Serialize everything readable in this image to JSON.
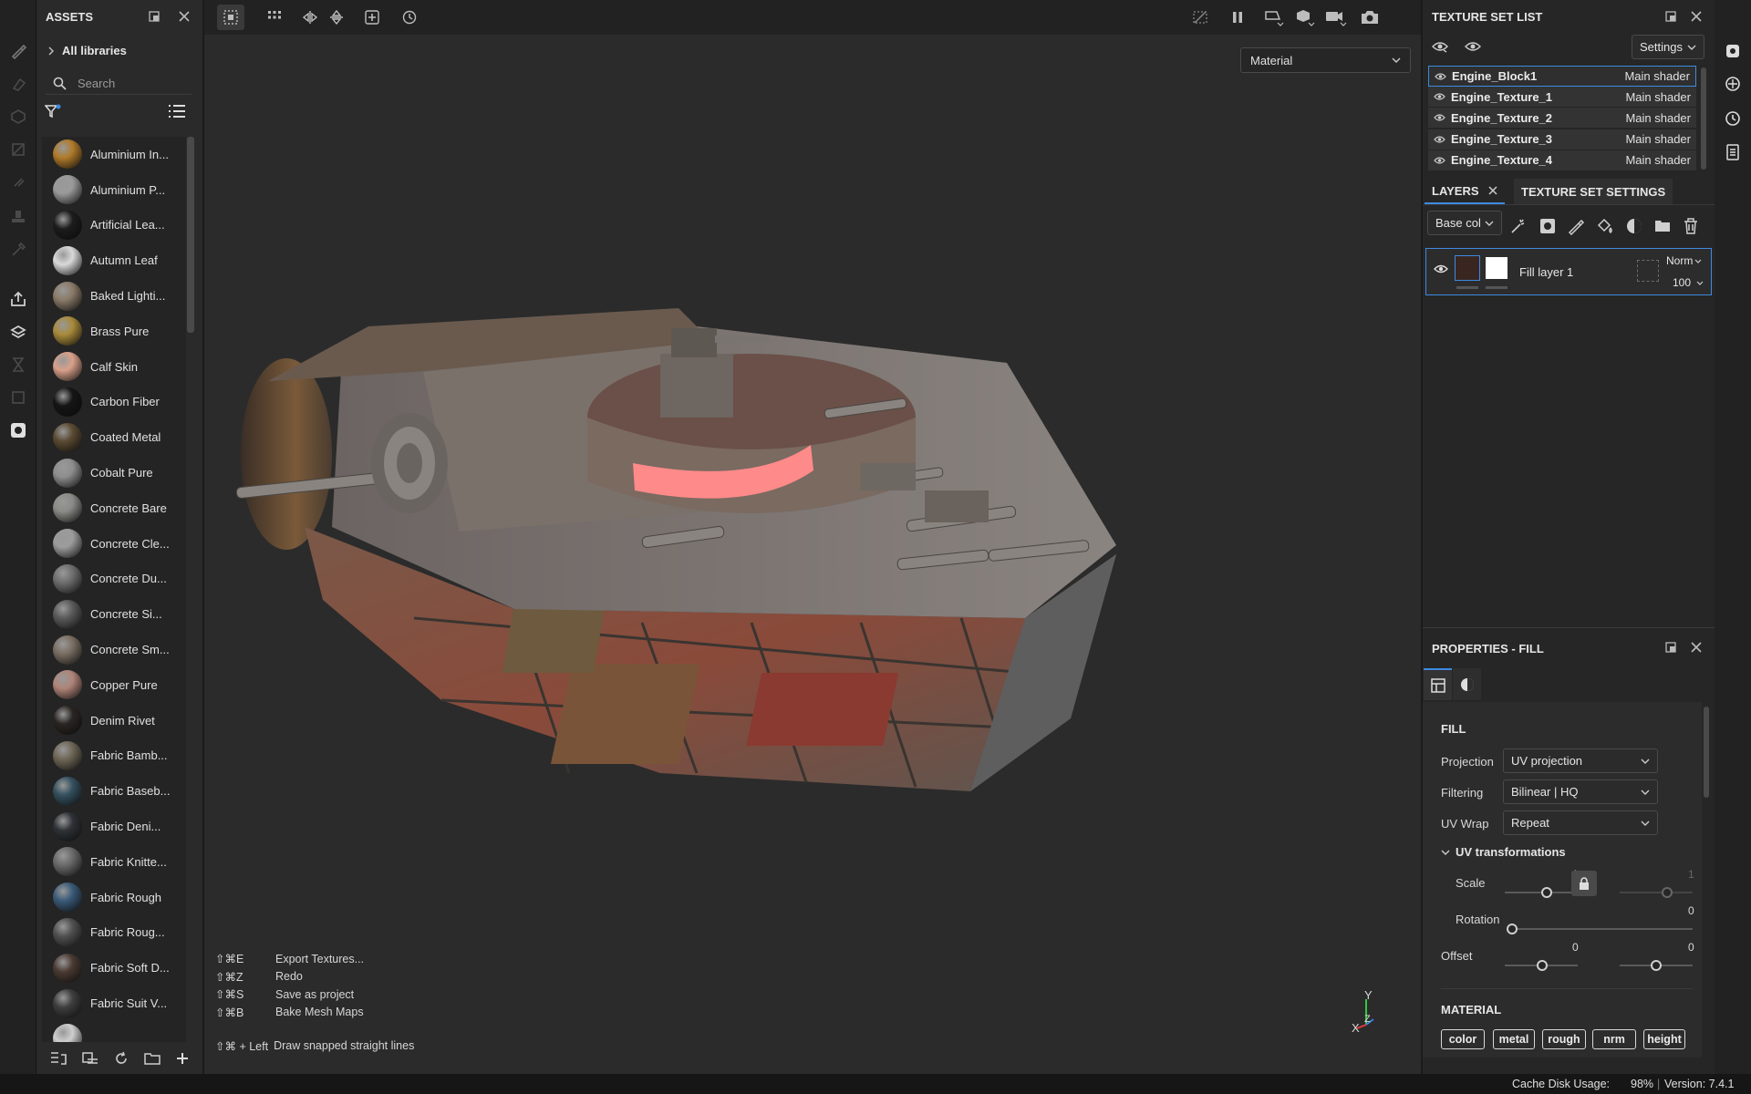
{
  "assets": {
    "title": "ASSETS",
    "all_libraries": "All libraries",
    "search_placeholder": "Search",
    "items": [
      {
        "label": "Aluminium In...",
        "color": "#b07a2a"
      },
      {
        "label": "Aluminium P...",
        "color": "#9a9a9a"
      },
      {
        "label": "Artificial Lea...",
        "color": "#1c1c1c"
      },
      {
        "label": "Autumn Leaf",
        "color": "#d9d9d9"
      },
      {
        "label": "Baked Lighti...",
        "color": "#8a7a68"
      },
      {
        "label": "Brass Pure",
        "color": "#a88a3a"
      },
      {
        "label": "Calf Skin",
        "color": "#d9a08a"
      },
      {
        "label": "Carbon Fiber",
        "color": "#151515"
      },
      {
        "label": "Coated Metal",
        "color": "#5a4a32"
      },
      {
        "label": "Cobalt Pure",
        "color": "#8e8e8e"
      },
      {
        "label": "Concrete Bare",
        "color": "#8a8a86"
      },
      {
        "label": "Concrete Cle...",
        "color": "#9c9c9c"
      },
      {
        "label": "Concrete Du...",
        "color": "#6e6e6e"
      },
      {
        "label": "Concrete Si...",
        "color": "#5a5a5a"
      },
      {
        "label": "Concrete Sm...",
        "color": "#7a6e62"
      },
      {
        "label": "Copper Pure",
        "color": "#b08478"
      },
      {
        "label": "Denim Rivet",
        "color": "#2a2522"
      },
      {
        "label": "Fabric Bamb...",
        "color": "#6e6656"
      },
      {
        "label": "Fabric Baseb...",
        "color": "#34505e"
      },
      {
        "label": "Fabric Deni...",
        "color": "#2e3236"
      },
      {
        "label": "Fabric Knitte...",
        "color": "#6a6a6a"
      },
      {
        "label": "Fabric Rough",
        "color": "#3a5a78"
      },
      {
        "label": "Fabric Roug...",
        "color": "#505050"
      },
      {
        "label": "Fabric Soft D...",
        "color": "#4a3a32"
      },
      {
        "label": "Fabric Suit V...",
        "color": "#3e3e3e"
      },
      {
        "label": "",
        "color": "#cfcfcf"
      }
    ]
  },
  "viewport": {
    "material_select": "Material",
    "shortcuts": [
      {
        "keys": "⇧⌘E",
        "action": "Export Textures..."
      },
      {
        "keys": "⇧⌘Z",
        "action": "Redo"
      },
      {
        "keys": "⇧⌘S",
        "action": "Save as project"
      },
      {
        "keys": "⇧⌘B",
        "action": "Bake Mesh Maps"
      }
    ],
    "snap_hint_keys": "⇧⌘ + Left",
    "snap_hint_action": "Draw snapped straight lines",
    "axis": {
      "x": "X",
      "y": "Y",
      "z": "Z"
    }
  },
  "texture_set_list": {
    "title": "TEXTURE SET LIST",
    "settings_label": "Settings",
    "items": [
      {
        "name": "Engine_Block1",
        "shader": "Main shader",
        "selected": true
      },
      {
        "name": "Engine_Texture_1",
        "shader": "Main shader",
        "selected": false
      },
      {
        "name": "Engine_Texture_2",
        "shader": "Main shader",
        "selected": false
      },
      {
        "name": "Engine_Texture_3",
        "shader": "Main shader",
        "selected": false
      },
      {
        "name": "Engine_Texture_4",
        "shader": "Main shader",
        "selected": false
      }
    ]
  },
  "layers": {
    "tab_layers": "LAYERS",
    "tab_texture_set_settings": "TEXTURE SET SETTINGS",
    "channel_select": "Base col",
    "layer_name": "Fill layer 1",
    "blend_mode": "Norm",
    "opacity": "100"
  },
  "properties": {
    "title": "PROPERTIES - FILL",
    "fill_header": "FILL",
    "projection_label": "Projection",
    "projection_value": "UV projection",
    "filtering_label": "Filtering",
    "filtering_value": "Bilinear | HQ",
    "uvwrap_label": "UV Wrap",
    "uvwrap_value": "Repeat",
    "uv_transformations": "UV transformations",
    "scale_label": "Scale",
    "scale_value": "1",
    "scale_value2": "1",
    "rotation_label": "Rotation",
    "rotation_value": "0",
    "offset_label": "Offset",
    "offset_x": "0",
    "offset_y": "0",
    "material_header": "MATERIAL",
    "channels": [
      "color",
      "metal",
      "rough",
      "nrm",
      "height"
    ]
  },
  "status": {
    "cache_label": "Cache Disk Usage:",
    "cache_value": "98%",
    "version": "Version: 7.4.1"
  },
  "colors": {
    "accent": "#3d8ae0",
    "glow": "#ff8080"
  }
}
